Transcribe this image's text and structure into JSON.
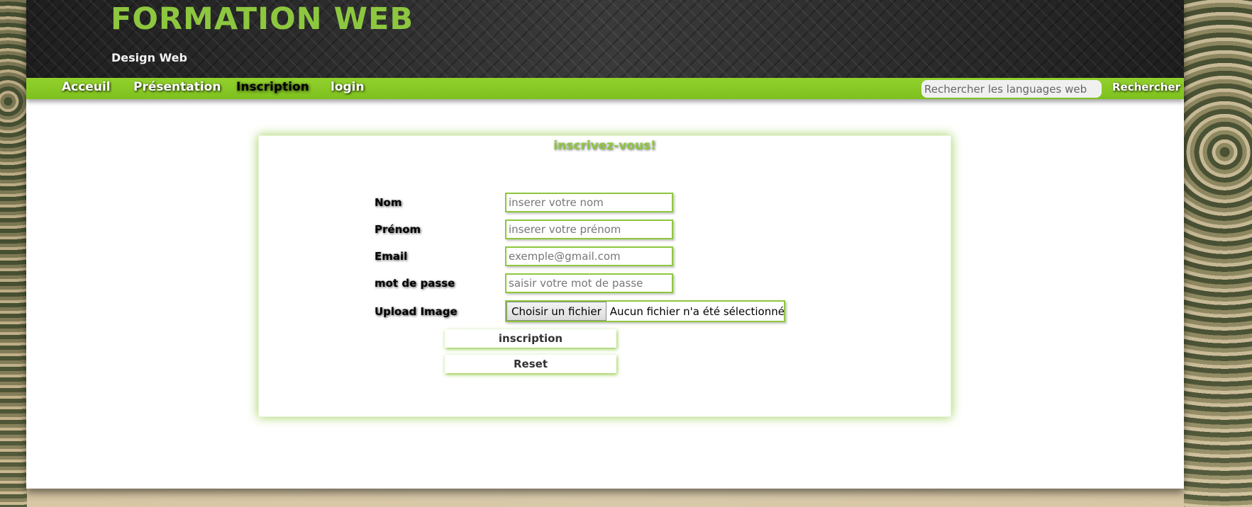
{
  "header": {
    "title": "FORMATION WEB",
    "subtitle": "Design Web"
  },
  "nav": {
    "items": [
      {
        "label": "Acceuil",
        "active": false
      },
      {
        "label": "Présentation",
        "active": false
      },
      {
        "label": "Inscription",
        "active": true
      },
      {
        "label": "login",
        "active": false
      }
    ],
    "search_placeholder": "Rechercher les languages web",
    "search_button": "Rechercher"
  },
  "form": {
    "title": "inscrivez-vous!",
    "fields": [
      {
        "label": "Nom",
        "placeholder": "inserer votre nom"
      },
      {
        "label": "Prénom",
        "placeholder": "inserer votre prénom"
      },
      {
        "label": "Email",
        "placeholder": "exemple@gmail.com"
      },
      {
        "label": "mot de passe",
        "placeholder": "saisir votre mot de passe"
      }
    ],
    "upload": {
      "label": "Upload Image",
      "button": "Choisir un fichier",
      "status": "Aucun fichier n'a été sélectionné"
    },
    "submit_label": "inscription",
    "reset_label": "Reset"
  },
  "colors": {
    "accent": "#8dc73f",
    "nav_bar": "#7dc01f",
    "header_bg": "#2a2a2a"
  }
}
